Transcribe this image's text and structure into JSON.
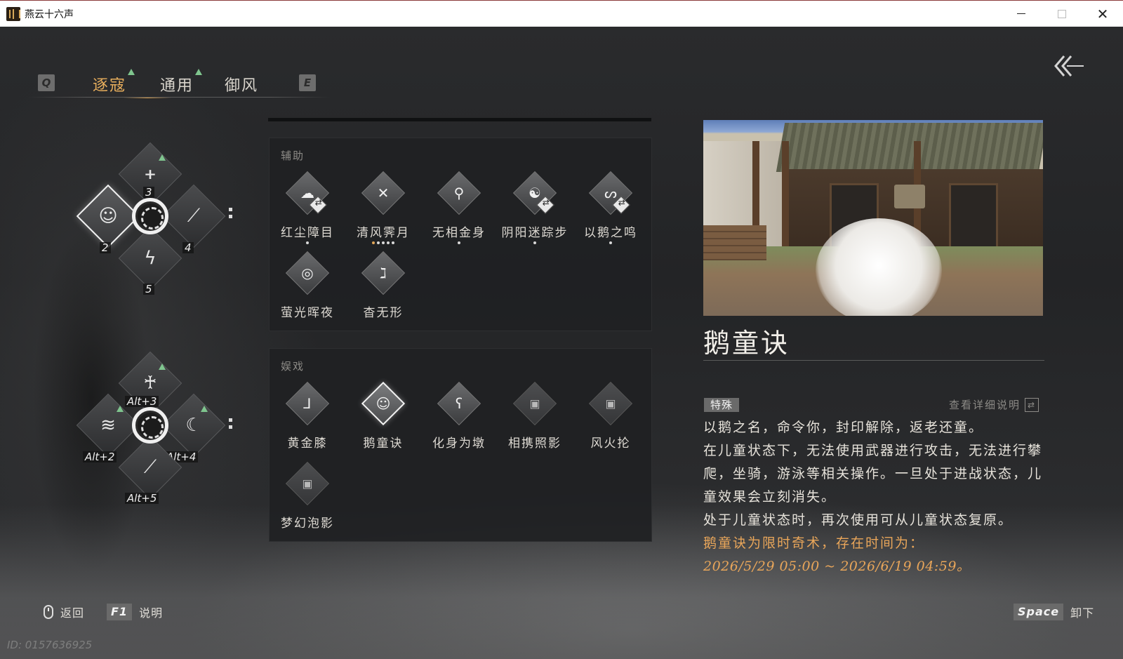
{
  "window": {
    "title": "燕云十六声",
    "icon": "app-logo-icon"
  },
  "tabs": {
    "prev_key": "Q",
    "next_key": "E",
    "items": [
      {
        "label": "逐寇",
        "active": true,
        "new": true
      },
      {
        "label": "通用",
        "active": false,
        "new": true
      },
      {
        "label": "御风",
        "active": false,
        "new": false
      }
    ]
  },
  "wheel_top": {
    "slots": [
      {
        "key": "3",
        "icon": "leaping-figure-icon",
        "new": true
      },
      {
        "key": "2",
        "icon": "child-figure-icon",
        "selected": true
      },
      {
        "key": "4",
        "icon": "feather-icon"
      },
      {
        "key": "5",
        "icon": "crane-icon"
      }
    ]
  },
  "wheel_bottom": {
    "slots": [
      {
        "key": "Alt+3",
        "icon": "archer-figure-icon",
        "new": true
      },
      {
        "key": "Alt+2",
        "icon": "wave-strike-icon",
        "new": true
      },
      {
        "key": "Alt+4",
        "icon": "crescent-slash-icon",
        "new": true
      },
      {
        "key": "Alt+5",
        "icon": "spear-icon"
      }
    ]
  },
  "panel_assist": {
    "title": "辅助",
    "skills": [
      {
        "label": "红尘障目",
        "icon": "dust-cloud-icon",
        "swap": true,
        "dots": 1
      },
      {
        "label": "清风霁月",
        "icon": "crossed-blades-icon",
        "swap": false,
        "dots": 5
      },
      {
        "label": "无相金身",
        "icon": "meditating-figure-icon",
        "swap": false,
        "dots": 1
      },
      {
        "label": "阴阳迷踪步",
        "icon": "yin-yang-icon",
        "swap": true,
        "dots": 1
      },
      {
        "label": "以鹅之鸣",
        "icon": "goose-icon",
        "swap": true,
        "dots": 1
      },
      {
        "label": "萤光晖夜",
        "icon": "swirl-icon",
        "swap": false,
        "dots": 0
      },
      {
        "label": "杳无形",
        "icon": "vanish-figure-icon",
        "swap": false,
        "dots": 0
      }
    ]
  },
  "panel_play": {
    "title": "娱戏",
    "skills": [
      {
        "label": "黄金膝",
        "icon": "kneel-icon",
        "locked": false
      },
      {
        "label": "鹅童诀",
        "icon": "child-figure-icon",
        "locked": false,
        "selected": true
      },
      {
        "label": "化身为墩",
        "icon": "bear-icon",
        "locked": false
      },
      {
        "label": "相携照影",
        "icon": "lock-icon",
        "locked": true
      },
      {
        "label": "风火抡",
        "icon": "lock-icon",
        "locked": true
      },
      {
        "label": "梦幻泡影",
        "icon": "lock-icon",
        "locked": true
      }
    ]
  },
  "detail": {
    "title": "鹅童诀",
    "tag": "特殊",
    "view_more": "查看详细说明",
    "lines": [
      "以鹅之名，命令你，封印解除，返老还童。",
      "在儿童状态下，无法使用武器进行攻击，无法进行攀爬，坐骑，游泳等相关操作。一旦处于进战状态，儿童效果会立刻消失。",
      "处于儿童状态时，再次使用可从儿童状态复原。"
    ],
    "limited_note": "鹅童诀为限时奇术，存在时间为：",
    "limited_period": "2026/5/29 05:00 ~ 2026/6/19 04:59。",
    "accent_color": "#e9a65a"
  },
  "bottom": {
    "back_label": "返回",
    "help_key": "F1",
    "help_label": "说明",
    "unequip_key": "Space",
    "unequip_label": "卸下",
    "uid": "ID: 0157636925"
  }
}
